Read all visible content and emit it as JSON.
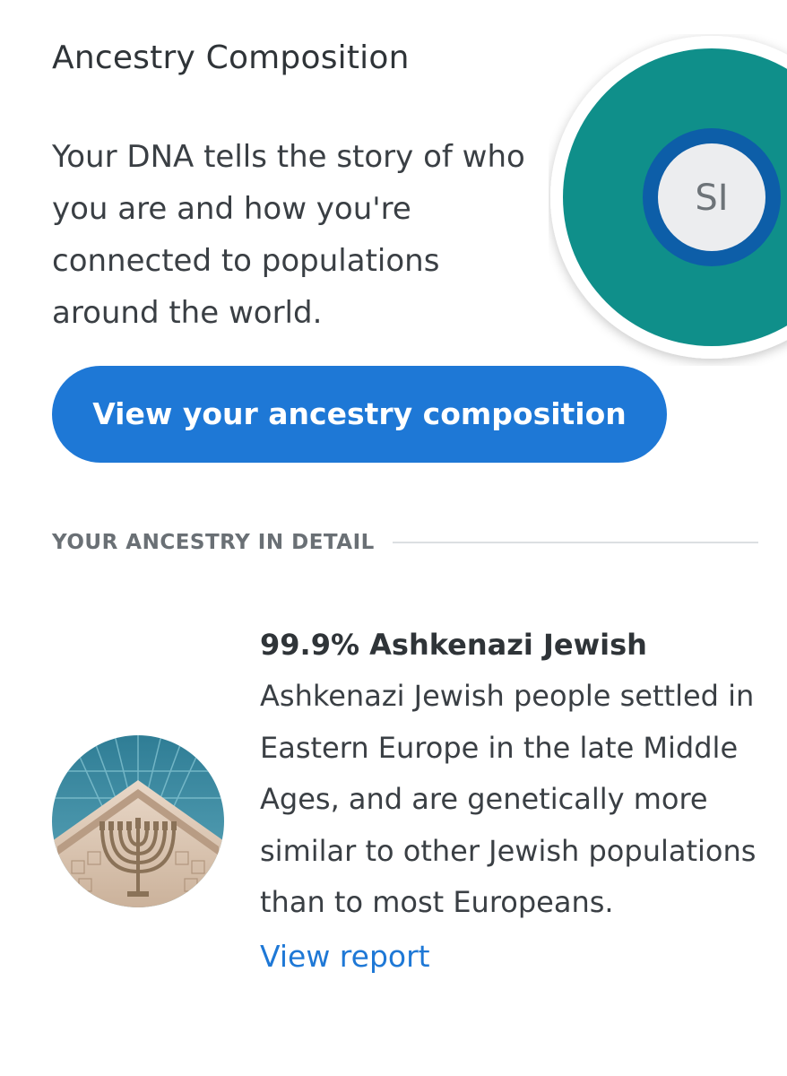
{
  "card": {
    "title": "Ancestry Composition",
    "description": "Your DNA tells the story of who you are and how you're connected to populations around the world.",
    "cta_label": "View your ancestry composition",
    "avatar_initials": "SI"
  },
  "chart_data": {
    "type": "pie",
    "slices": [
      {
        "name": "Ashkenazi Jewish",
        "value": 99.9,
        "color": "#0f8f8a"
      }
    ],
    "center_label": "SI"
  },
  "section": {
    "label": "YOUR ANCESTRY IN DETAIL"
  },
  "populations": [
    {
      "name": "99.9% Ashkenazi Jewish",
      "description": "Ashkenazi Jewish people settled in Eastern Europe in the late Middle Ages, and are genetically more similar to other Jewish populations than to most Europeans.",
      "link_label": "View report",
      "image_icon": "menorah-icon"
    }
  ],
  "colors": {
    "accent": "#1e78d6",
    "teal": "#0f8f8a",
    "ring_blue": "#0d5ea8"
  }
}
